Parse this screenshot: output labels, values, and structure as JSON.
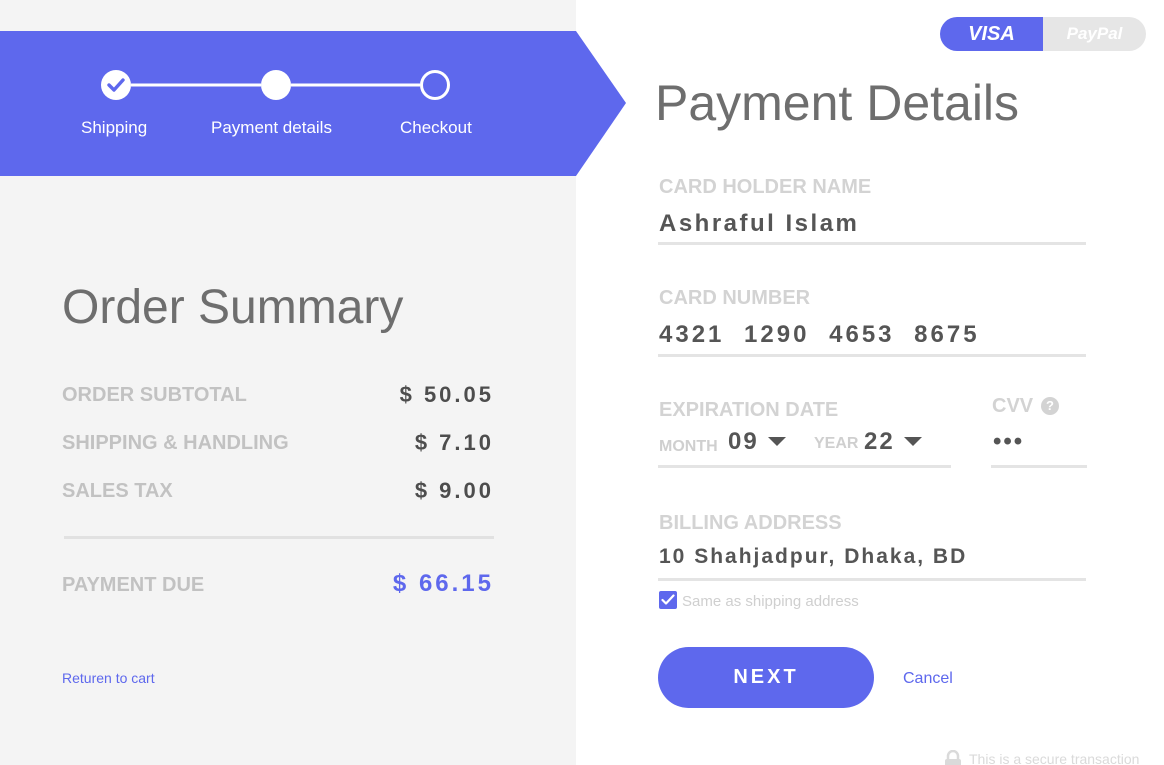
{
  "steps": [
    {
      "label": "Shipping",
      "state": "done"
    },
    {
      "label": "Payment details",
      "state": "current"
    },
    {
      "label": "Checkout",
      "state": "pending"
    }
  ],
  "colors": {
    "accent": "#5e68ed",
    "panel_bg": "#f4f4f4",
    "muted_label": "#c2c2c2",
    "value_text": "#555555"
  },
  "order_summary": {
    "title": "Order Summary",
    "rows": [
      {
        "label": "ORDER SUBTOTAL",
        "value": "$ 50.05"
      },
      {
        "label": "SHIPPING & HANDLING",
        "value": "$ 7.10"
      },
      {
        "label": "SALES TAX",
        "value": "$ 9.00"
      }
    ],
    "due": {
      "label": "PAYMENT DUE",
      "value": "$ 66.15"
    },
    "return_link": "Returen to cart"
  },
  "payment": {
    "methods": [
      {
        "label": "VISA",
        "selected": true
      },
      {
        "label": "PayPal",
        "selected": false
      }
    ],
    "title": "Payment Details",
    "card_holder": {
      "label": "CARD HOLDER NAME",
      "value": "Ashraful Islam"
    },
    "card_number": {
      "label": "CARD NUMBER",
      "value": "4321 1290 4653 8675"
    },
    "expiration": {
      "label": "EXPIRATION DATE",
      "month_label": "MONTH",
      "month": "09",
      "year_label": "YEAR",
      "year": "22"
    },
    "cvv": {
      "label": "CVV",
      "help": "?",
      "value": "•••"
    },
    "billing": {
      "label": "BILLING ADDRESS",
      "value": "10 Shahjadpur, Dhaka, BD"
    },
    "same_as_shipping": {
      "label": "Same as shipping address",
      "checked": true
    },
    "next_label": "NEXT",
    "cancel_label": "Cancel",
    "secure_note": "This is a secure transaction",
    "icons": [
      "check-icon",
      "caret-down-icon",
      "help-icon",
      "lock-icon"
    ]
  }
}
